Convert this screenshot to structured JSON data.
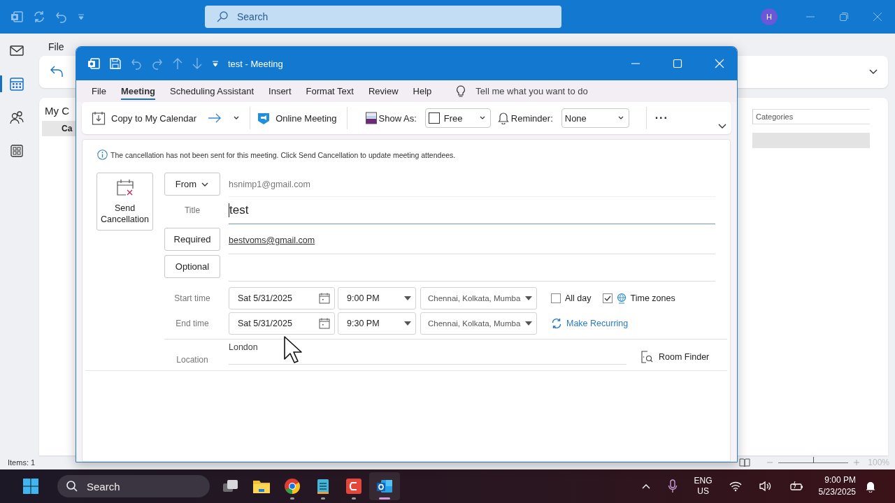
{
  "app": {
    "search": {
      "placeholder": "Search"
    },
    "avatar": "H"
  },
  "menu": [
    "File"
  ],
  "nav_rail": [
    {
      "kind": "mail",
      "selected": false
    },
    {
      "kind": "calendar",
      "selected": true
    },
    {
      "kind": "people",
      "selected": false
    },
    {
      "kind": "apps",
      "selected": false
    }
  ],
  "folder_pane": {
    "heading": "My C",
    "item": "Ca"
  },
  "list": {
    "column": "Categories"
  },
  "status_bar": {
    "items": "Items: 1",
    "zoom_slider": {
      "level": 0.5
    },
    "zoom": "100%"
  },
  "meeting": {
    "title": "test - Meeting",
    "tabs": [
      {
        "label": "File",
        "selected": false
      },
      {
        "label": "Meeting",
        "selected": true
      },
      {
        "label": "Scheduling Assistant",
        "selected": false
      },
      {
        "label": "Insert",
        "selected": false
      },
      {
        "label": "Format Text",
        "selected": false
      },
      {
        "label": "Review",
        "selected": false
      },
      {
        "label": "Help",
        "selected": false
      }
    ],
    "tell_me": {
      "placeholder": "Tell me what you want to do"
    },
    "ribbon": {
      "copy": "Copy to My Calendar",
      "online": "Online Meeting",
      "show_as_label": "Show As:",
      "show_as": "Free",
      "reminder_label": "Reminder:",
      "reminder": "None",
      "more": "···"
    },
    "info": "The cancellation has not been sent for this meeting. Click Send Cancellation to update meeting attendees.",
    "send_cancellation": "Send Cancellation",
    "from": {
      "button": "From",
      "value": "hsnimp1@gmail.com"
    },
    "title_field": {
      "label": "Title",
      "value": "test"
    },
    "required": {
      "button": "Required",
      "value": "bestvoms@gmail.com"
    },
    "optional": {
      "button": "Optional"
    },
    "start": {
      "label": "Start time",
      "date": "Sat 5/31/2025",
      "time": "9:00 PM",
      "zone": "Chennai, Kolkata, Mumba"
    },
    "end": {
      "label": "End time",
      "date": "Sat 5/31/2025",
      "time": "9:30 PM",
      "zone": "Chennai, Kolkata, Mumba"
    },
    "all_day": {
      "label": "All day",
      "checked": false
    },
    "time_zones": {
      "label": "Time zones",
      "checked": true
    },
    "make_recurring": "Make Recurring",
    "location": {
      "label": "Location",
      "value": "London"
    },
    "room_finder": "Room Finder"
  },
  "taskbar": {
    "search": {
      "placeholder": "Search"
    },
    "apps": [
      {
        "kind": "task-view",
        "running": false,
        "selected": false
      },
      {
        "kind": "folder",
        "running": false,
        "selected": false
      },
      {
        "kind": "chrome",
        "running": true,
        "selected": false
      },
      {
        "kind": "notepad",
        "running": true,
        "selected": false
      },
      {
        "kind": "camtasia",
        "running": true,
        "selected": false
      },
      {
        "kind": "outlook",
        "running": true,
        "selected": true
      }
    ],
    "language": "ENG",
    "region": "US",
    "time": "9:00 PM",
    "date": "5/23/2025"
  }
}
